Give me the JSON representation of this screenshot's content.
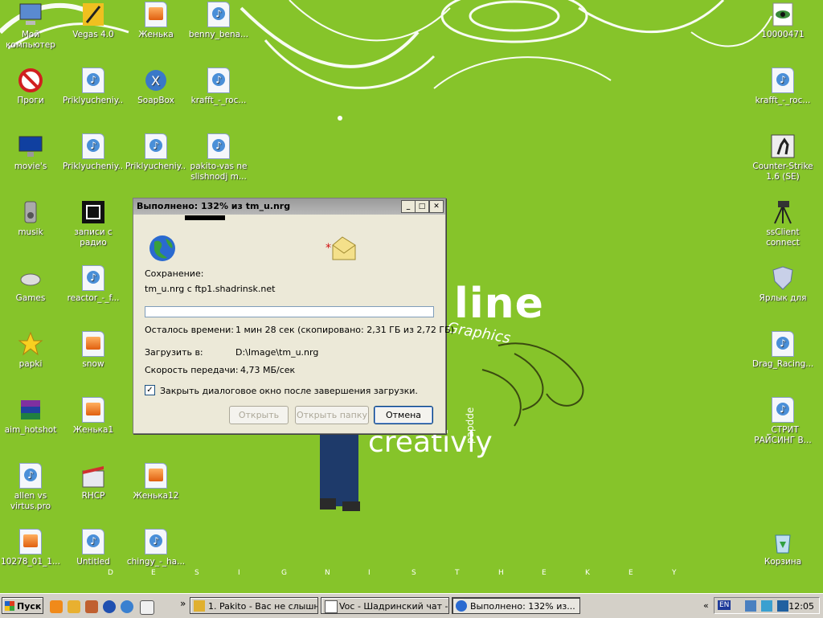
{
  "desktop": {
    "icons": [
      {
        "label": "Мой компьютер",
        "icon": "computer-icon"
      },
      {
        "label": "Vegas 4.0",
        "icon": "vegas-icon"
      },
      {
        "label": "Женька",
        "icon": "audio-file-icon"
      },
      {
        "label": "benny_bena...",
        "icon": "media-file-icon"
      },
      {
        "label": "10000471",
        "icon": "gif-image-icon"
      },
      {
        "label": "Проги",
        "icon": "folder-forbidden-icon"
      },
      {
        "label": "Priklyucheniy...",
        "icon": "media-file-icon"
      },
      {
        "label": "SoapBox",
        "icon": "soapbox-icon"
      },
      {
        "label": "krafft_-_roc...",
        "icon": "media-file-icon"
      },
      {
        "label": "krafft_-_roc...",
        "icon": "media-file-icon"
      },
      {
        "label": "movie's",
        "icon": "monitor-icon"
      },
      {
        "label": "Priklyucheniy...",
        "icon": "media-file-icon"
      },
      {
        "label": "Priklyucheniy...",
        "icon": "media-file-icon"
      },
      {
        "label": "pakito-vas ne slishnodj m...",
        "icon": "media-file-icon"
      },
      {
        "label": "Counter-Strike 1.6 (SE)",
        "icon": "counter-strike-icon"
      },
      {
        "label": "musik",
        "icon": "speaker-icon"
      },
      {
        "label": "записи с радио",
        "icon": "radio-folder-icon"
      },
      {
        "label": "ssClient connect",
        "icon": "tripod-icon"
      },
      {
        "label": "Games",
        "icon": "mouse-icon"
      },
      {
        "label": "reactor_-_f...",
        "icon": "media-file-icon"
      },
      {
        "label": "Ярлык для",
        "icon": "shield-icon"
      },
      {
        "label": "papki",
        "icon": "star-icon"
      },
      {
        "label": "snow",
        "icon": "audio-file-icon"
      },
      {
        "label": "Drag_Racing...",
        "icon": "media-file-icon"
      },
      {
        "label": "aim_hotshot",
        "icon": "winrar-icon"
      },
      {
        "label": "Женька1",
        "icon": "audio-file-icon"
      },
      {
        "label": "_СТРИТ РАЙСИНГ В...",
        "icon": "media-file-icon"
      },
      {
        "label": "allen vs virtus.pro",
        "icon": "media-file-icon"
      },
      {
        "label": "RHCP",
        "icon": "clapper-icon"
      },
      {
        "label": "Женька12",
        "icon": "audio-file-icon"
      },
      {
        "label": "10278_01_1...",
        "icon": "audio-file-icon"
      },
      {
        "label": "Untitled",
        "icon": "media-file-icon"
      },
      {
        "label": "chingy_-_ha...",
        "icon": "media-file-icon"
      },
      {
        "label": "Корзина",
        "icon": "recycle-bin-icon"
      }
    ],
    "wallpaper": {
      "word1": "line",
      "word2": "creativly",
      "word3": "Graphics",
      "word4": "papdde",
      "tagline": [
        "D",
        "E",
        "S",
        "I",
        "G",
        "N",
        "I",
        "S",
        "T",
        "H",
        "E",
        "K",
        "E",
        "Y"
      ]
    }
  },
  "dialog": {
    "title": "Выполнено: 132% из tm_u.nrg",
    "saving_label": "Сохранение:",
    "saving_value": "tm_u.nrg с ftp1.shadrinsk.net",
    "progress": 0,
    "time_left_label": "Осталось времени:",
    "time_left_value": "1 мин 28 сек (скопировано: 2,31 ГБ из 2,72 ГБ)",
    "download_to_label": "Загрузить в:",
    "download_to_value": "D:\\Image\\tm_u.nrg",
    "speed_label": "Скорость передачи:",
    "speed_value": "4,73 МБ/сек",
    "close_checkbox_label": "Закрыть диалоговое окно после завершения загрузки.",
    "close_checkbox_checked": true,
    "open_button": "Открыть",
    "open_folder_button": "Открыть папку",
    "cancel_button": "Отмена",
    "minimize": "_",
    "maximize": "□",
    "close": "✕"
  },
  "taskbar": {
    "start_label": "Пуск",
    "chevron": "»",
    "tasks": [
      {
        "label": "1. Pakito - Вас не слышн...",
        "icon": "winamp-icon"
      },
      {
        "label": "Voc - Шадринский чат -...",
        "icon": "browser-window-icon"
      },
      {
        "label": "Выполнено: 132% из...",
        "icon": "download-icon",
        "active": true
      }
    ],
    "tray_chevron": "«",
    "language": "EN",
    "clock": "12:05"
  }
}
